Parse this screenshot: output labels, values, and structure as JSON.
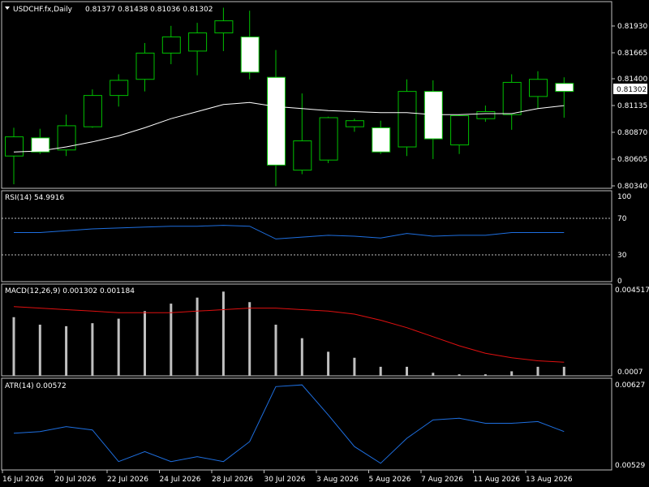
{
  "header": {
    "symbol_label": "USDCHF.fx,Daily",
    "ohlc_label": "0.81377 0.81438 0.81036 0.81302"
  },
  "colors": {
    "background": "#000000",
    "frame": "#c0c0c0",
    "bull_outline": "#00c000",
    "bull_fill": "#000000",
    "bear_outline": "#00c000",
    "bear_fill": "#ffffff",
    "ma": "#ffffff",
    "rsi": "#1e6fe0",
    "macd_hist": "#c0c0c0",
    "macd_signal": "#e01010",
    "atr": "#1e6fe0",
    "price_tag": "#ffffff"
  },
  "price_axis": {
    "ticks": [
      "0.81930",
      "0.81665",
      "0.81400",
      "0.81135",
      "0.80870",
      "0.80605",
      "0.80340"
    ],
    "current_price": "0.81302"
  },
  "rsi": {
    "label": "RSI(14) 54.9916",
    "ticks": [
      "100",
      "70",
      "30",
      "0"
    ],
    "levels": [
      70,
      30
    ]
  },
  "macd": {
    "label": "MACD(12,26,9) 0.001302 0.001184",
    "ticks": [
      "0.004517",
      "0.0007"
    ]
  },
  "atr": {
    "label": "ATR(14) 0.00572",
    "ticks": [
      "0.00627",
      "0.00529"
    ]
  },
  "time_axis": {
    "labels": [
      "16 Jul 2026",
      "20 Jul 2026",
      "22 Jul 2026",
      "24 Jul 2026",
      "28 Jul 2026",
      "30 Jul 2026",
      "3 Aug 2026",
      "5 Aug 2026",
      "7 Aug 2026",
      "11 Aug 2026",
      "13 Aug 2026"
    ]
  },
  "chart_data": {
    "type": "candlestick",
    "price_range": [
      0.8034,
      0.8219
    ],
    "candles": [
      {
        "open": 0.8066,
        "high": 0.8094,
        "low": 0.8038,
        "close": 0.8085
      },
      {
        "open": 0.8084,
        "high": 0.8093,
        "low": 0.8068,
        "close": 0.807
      },
      {
        "open": 0.8072,
        "high": 0.8107,
        "low": 0.8066,
        "close": 0.8096
      },
      {
        "open": 0.8095,
        "high": 0.8132,
        "low": 0.8094,
        "close": 0.8126
      },
      {
        "open": 0.8126,
        "high": 0.8147,
        "low": 0.8115,
        "close": 0.8141
      },
      {
        "open": 0.8142,
        "high": 0.8178,
        "low": 0.813,
        "close": 0.8168
      },
      {
        "open": 0.8168,
        "high": 0.8195,
        "low": 0.8157,
        "close": 0.8184
      },
      {
        "open": 0.817,
        "high": 0.8198,
        "low": 0.8146,
        "close": 0.8188
      },
      {
        "open": 0.8188,
        "high": 0.8213,
        "low": 0.817,
        "close": 0.82
      },
      {
        "open": 0.8184,
        "high": 0.821,
        "low": 0.8142,
        "close": 0.8149
      },
      {
        "open": 0.8144,
        "high": 0.8171,
        "low": 0.8036,
        "close": 0.8057
      },
      {
        "open": 0.8052,
        "high": 0.8128,
        "low": 0.8048,
        "close": 0.8081
      },
      {
        "open": 0.8062,
        "high": 0.8105,
        "low": 0.8059,
        "close": 0.8104
      },
      {
        "open": 0.8095,
        "high": 0.8103,
        "low": 0.809,
        "close": 0.8101
      },
      {
        "open": 0.8094,
        "high": 0.8101,
        "low": 0.8068,
        "close": 0.807
      },
      {
        "open": 0.8075,
        "high": 0.8142,
        "low": 0.8066,
        "close": 0.813
      },
      {
        "open": 0.813,
        "high": 0.8141,
        "low": 0.8063,
        "close": 0.8083
      },
      {
        "open": 0.8077,
        "high": 0.8107,
        "low": 0.8068,
        "close": 0.8106
      },
      {
        "open": 0.8103,
        "high": 0.8116,
        "low": 0.81,
        "close": 0.811
      },
      {
        "open": 0.8107,
        "high": 0.8147,
        "low": 0.8092,
        "close": 0.8139
      },
      {
        "open": 0.8125,
        "high": 0.815,
        "low": 0.8113,
        "close": 0.8142
      },
      {
        "open": 0.8138,
        "high": 0.8144,
        "low": 0.8104,
        "close": 0.813
      }
    ],
    "ma_line": [
      0.807,
      0.8071,
      0.8075,
      0.808,
      0.8086,
      0.8094,
      0.8103,
      0.811,
      0.8117,
      0.8119,
      0.8115,
      0.8113,
      0.8111,
      0.811,
      0.8109,
      0.8109,
      0.8107,
      0.8107,
      0.8108,
      0.8108,
      0.8113,
      0.8116
    ],
    "rsi_values": [
      54,
      54,
      56,
      58,
      59,
      60,
      61,
      61,
      62,
      61,
      47,
      49,
      51,
      50,
      48,
      53,
      50,
      51,
      51,
      54,
      54,
      54
    ],
    "macd_histogram": [
      0.0042,
      0.0037,
      0.0036,
      0.0038,
      0.0041,
      0.0046,
      0.0051,
      0.0055,
      0.0059,
      0.0052,
      0.0037,
      0.0028,
      0.0019,
      0.0015,
      0.0009,
      0.0009,
      0.0005,
      0.0004,
      0.0004,
      0.0006,
      0.0009,
      0.0009
    ],
    "macd_signal": [
      0.0049,
      0.0048,
      0.0047,
      0.0046,
      0.0045,
      0.0045,
      0.0045,
      0.0046,
      0.0047,
      0.0048,
      0.0048,
      0.0047,
      0.0046,
      0.0044,
      0.004,
      0.0035,
      0.0029,
      0.0023,
      0.0018,
      0.0015,
      0.0013,
      0.0012
    ],
    "macd_range": [
      0.0003,
      0.0064
    ],
    "atr_values": [
      0.00594,
      0.00595,
      0.00598,
      0.00596,
      0.00577,
      0.00583,
      0.00577,
      0.0058,
      0.00577,
      0.00589,
      0.00622,
      0.00623,
      0.00605,
      0.00586,
      0.00576,
      0.00591,
      0.00602,
      0.00603,
      0.006,
      0.006,
      0.00601,
      0.00595
    ],
    "atr_range": [
      0.00572,
      0.00627
    ]
  }
}
